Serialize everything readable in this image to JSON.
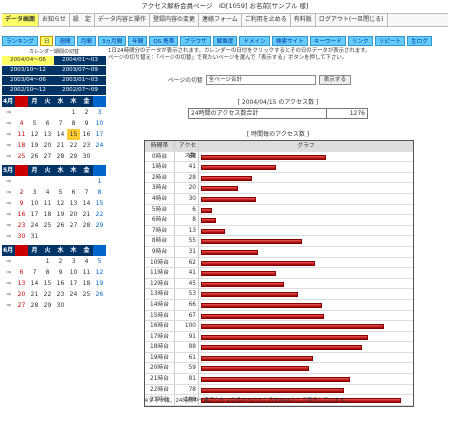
{
  "window": {
    "title": "アクセス解析会員ページ　ID[1059] お名前[サンプル 様]"
  },
  "nav": [
    {
      "label": "データ画面",
      "active": true
    },
    {
      "label": "お知らせ",
      "active": false
    },
    {
      "label": "設　定",
      "active": false
    },
    {
      "label": "データ内容と操作",
      "active": false
    },
    {
      "label": "登録内容の変更",
      "active": false
    },
    {
      "label": "連絡フォーム",
      "active": false
    },
    {
      "label": "ご利用を止める",
      "active": false
    },
    {
      "label": "有料版",
      "active": false
    },
    {
      "label": "ログアウト(一旦閉じる)",
      "active": false
    }
  ],
  "tabs": [
    {
      "label": "ランキング",
      "active": false
    },
    {
      "label": "日",
      "active": true
    },
    {
      "label": "週間",
      "active": false
    },
    {
      "label": "月間",
      "active": false
    },
    {
      "label": "3ヵ月間",
      "active": false
    },
    {
      "label": "年間",
      "active": false
    },
    {
      "label": "OS 携帯",
      "active": false
    },
    {
      "label": "ブラウザ",
      "active": false
    },
    {
      "label": "解像度",
      "active": false
    },
    {
      "label": "ドメイン",
      "active": false
    },
    {
      "label": "検索サイト",
      "active": false
    },
    {
      "label": "キーワード",
      "active": false
    },
    {
      "label": "リンク",
      "active": false
    },
    {
      "label": "リピート",
      "active": false
    },
    {
      "label": "生ログ",
      "active": false
    }
  ],
  "sidebar": {
    "title": "カレンダー期間の切替",
    "periods": [
      {
        "start": "2004/04〜06",
        "end": "2004/01〜03"
      },
      {
        "start": "2003/10〜12",
        "end": "2003/07〜09"
      },
      {
        "start": "2003/04〜06",
        "end": "2003/01〜03"
      },
      {
        "start": "2002/10〜12",
        "end": "2002/07〜09"
      }
    ]
  },
  "calendars": [
    {
      "month": "4月",
      "days": [
        "日",
        "月",
        "火",
        "水",
        "木",
        "金",
        "土"
      ],
      "weeks": [
        [
          "",
          "",
          "",
          "",
          "1",
          "2",
          "3"
        ],
        [
          "4",
          "5",
          "6",
          "7",
          "8",
          "9",
          "10"
        ],
        [
          "11",
          "12",
          "13",
          "14",
          "15",
          "16",
          "17"
        ],
        [
          "18",
          "19",
          "20",
          "21",
          "22",
          "23",
          "24"
        ],
        [
          "25",
          "26",
          "27",
          "28",
          "29",
          "30",
          ""
        ]
      ],
      "today": "15"
    },
    {
      "month": "5月",
      "days": [
        "日",
        "月",
        "火",
        "水",
        "木",
        "金",
        "土"
      ],
      "weeks": [
        [
          "",
          "",
          "",
          "",
          "",
          "",
          "1"
        ],
        [
          "2",
          "3",
          "4",
          "5",
          "6",
          "7",
          "8"
        ],
        [
          "9",
          "10",
          "11",
          "12",
          "13",
          "14",
          "15"
        ],
        [
          "16",
          "17",
          "18",
          "19",
          "20",
          "21",
          "22"
        ],
        [
          "23",
          "24",
          "25",
          "26",
          "27",
          "28",
          "29"
        ],
        [
          "30",
          "31",
          "",
          "",
          "",
          "",
          ""
        ]
      ],
      "today": ""
    },
    {
      "month": "6月",
      "days": [
        "日",
        "月",
        "火",
        "水",
        "木",
        "金",
        "土"
      ],
      "weeks": [
        [
          "",
          "",
          "1",
          "2",
          "3",
          "4",
          "5"
        ],
        [
          "6",
          "7",
          "8",
          "9",
          "10",
          "11",
          "12"
        ],
        [
          "13",
          "14",
          "15",
          "16",
          "17",
          "18",
          "19"
        ],
        [
          "20",
          "21",
          "22",
          "23",
          "24",
          "25",
          "26"
        ],
        [
          "27",
          "28",
          "29",
          "30",
          "",
          "",
          ""
        ]
      ],
      "today": ""
    }
  ],
  "main": {
    "info_line1": "1日24時間分のデータが表示されます。カレンダーの日付をクリックするとその日のデータが表示されます。",
    "info_line2": "ページの切り替え：「ページの切替」で見たいページを選んで「表示する」ボタンを押して下さい。",
    "selector_label": "ページの切替",
    "selector_value": "全ページ合計",
    "show_button": "表示する",
    "date_heading": "[ 2004/04/15 のアクセス数 ]",
    "summary_label": "24時間のアクセス数合計",
    "summary_value": "1276",
    "hourly_heading": "[ 時間毎のアクセス数 ]",
    "footnote": "※グラフは、24時間中一番アクセスの多かったところをMAXとして表示しています。"
  },
  "chart_data": {
    "type": "bar",
    "columns": [
      "時間帯",
      "アクセス数",
      "グラフ"
    ],
    "categories": [
      "0時台",
      "1時台",
      "2時台",
      "3時台",
      "4時台",
      "5時台",
      "6時台",
      "7時台",
      "8時台",
      "9時台",
      "10時台",
      "11時台",
      "12時台",
      "13時台",
      "14時台",
      "15時台",
      "16時台",
      "17時台",
      "18時台",
      "19時台",
      "20時台",
      "21時台",
      "22時台",
      "23時台"
    ],
    "values": [
      68,
      41,
      28,
      20,
      30,
      6,
      8,
      13,
      55,
      31,
      62,
      41,
      45,
      53,
      66,
      67,
      100,
      91,
      88,
      61,
      59,
      81,
      78,
      109
    ],
    "max": 109
  }
}
